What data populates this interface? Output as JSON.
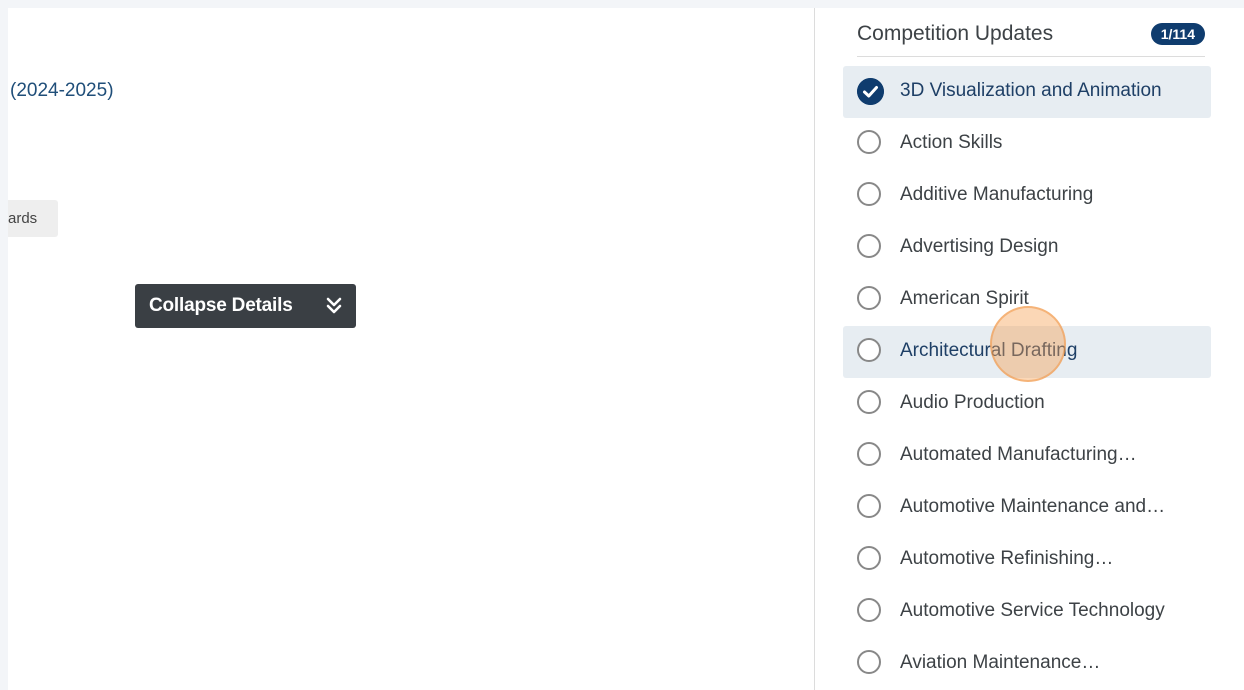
{
  "main": {
    "title_fragment": "(2024-2025)",
    "tag_fragment": "ards",
    "collapse_button_label": "Collapse Details"
  },
  "sidebar": {
    "title": "Competition Updates",
    "count_badge": "1/114",
    "items": [
      {
        "label": "3D Visualization and Animation",
        "checked": true
      },
      {
        "label": "Action Skills",
        "checked": false
      },
      {
        "label": "Additive Manufacturing",
        "checked": false
      },
      {
        "label": "Advertising Design",
        "checked": false
      },
      {
        "label": "American Spirit",
        "checked": false
      },
      {
        "label": "Architectural Drafting",
        "checked": false
      },
      {
        "label": "Audio Production",
        "checked": false
      },
      {
        "label": "Automated Manufacturing…",
        "checked": false
      },
      {
        "label": "Automotive Maintenance and…",
        "checked": false
      },
      {
        "label": "Automotive Refinishing…",
        "checked": false
      },
      {
        "label": "Automotive Service Technology",
        "checked": false
      },
      {
        "label": "Aviation Maintenance…",
        "checked": false
      }
    ]
  },
  "colors": {
    "accent": "#0f3c6e",
    "selected_background": "#e7edf2",
    "button_background": "#3a3f44",
    "link_text": "#1f4e79"
  }
}
